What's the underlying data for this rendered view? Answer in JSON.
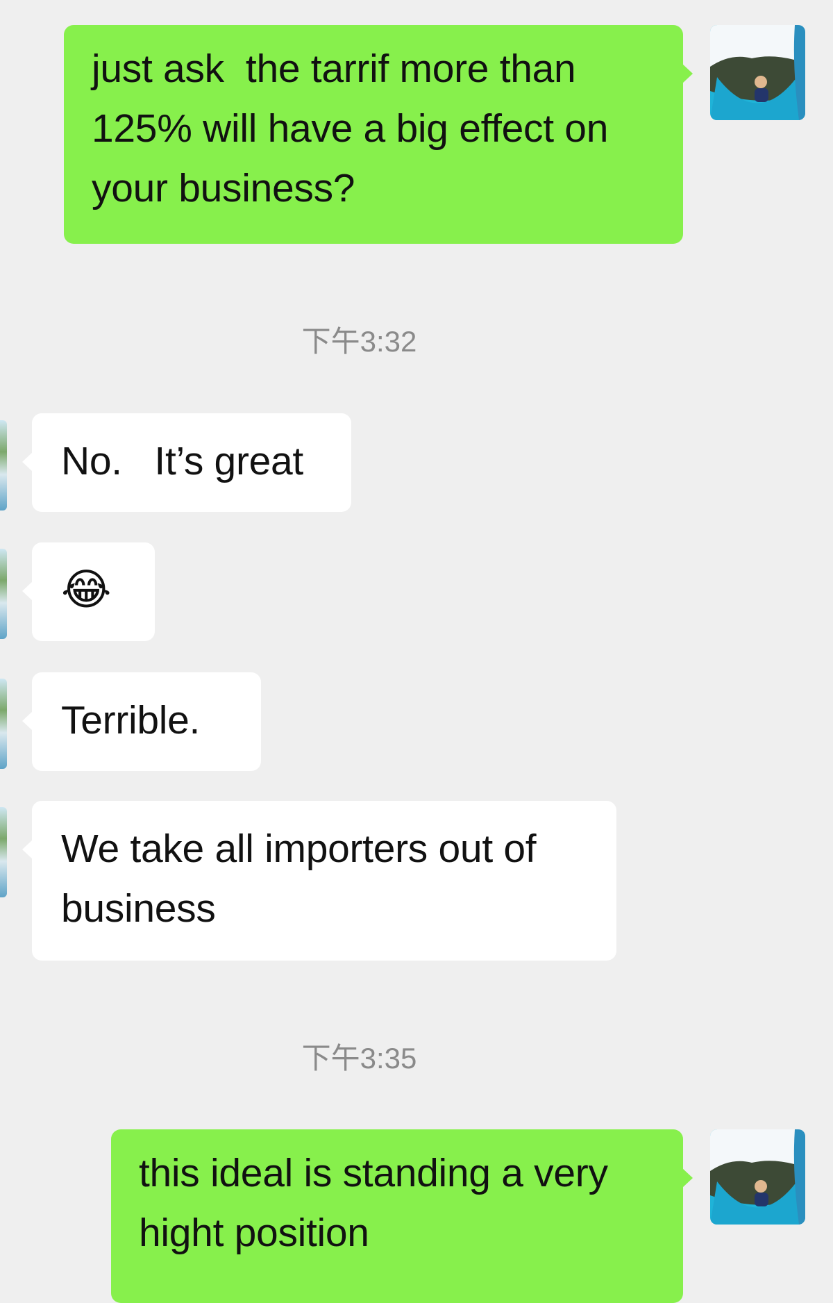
{
  "app": {
    "background": "#efefef",
    "sent_bubble_color": "#87f04c",
    "received_bubble_color": "#ffffff",
    "timestamp_color": "#8a8a8a"
  },
  "messages": [
    {
      "side": "sent",
      "text": "just ask  the tarrif more than 125% will have a big effect on your business?"
    },
    {
      "side": "received",
      "text": "No.   It’s great"
    },
    {
      "side": "received",
      "text": "😂"
    },
    {
      "side": "received",
      "text": "Terrible."
    },
    {
      "side": "received",
      "text": "We take all importers out of business"
    },
    {
      "side": "sent",
      "text": "this ideal is standing a very hight position"
    }
  ],
  "timestamps": [
    "下午3:32",
    "下午3:35"
  ],
  "avatars": {
    "self_icon": "user-photo-icon",
    "contact_icon": "contact-photo-icon"
  }
}
